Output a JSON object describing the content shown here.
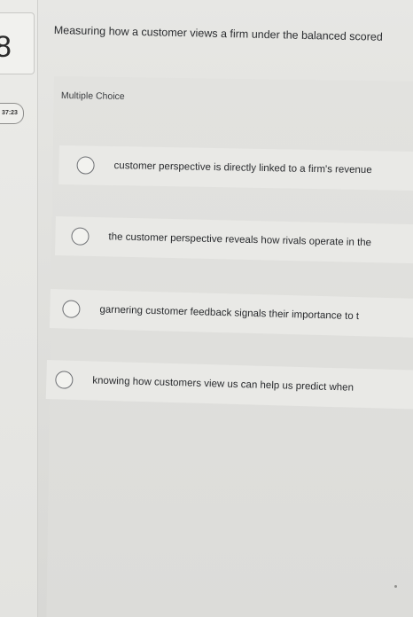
{
  "question_number": "8",
  "timer": "37:23",
  "question_text": "Measuring how a customer views a firm under the balanced scored",
  "question_type": "Multiple Choice",
  "options": [
    {
      "label": "customer perspective is directly linked to a firm's revenue"
    },
    {
      "label": "the customer perspective reveals how rivals operate in the"
    },
    {
      "label": "garnering customer feedback signals their importance to t"
    },
    {
      "label": "knowing how customers view us can help us predict when"
    }
  ],
  "colors": {
    "background": "#e3e3e0",
    "option_row": "#e9e9e6",
    "radio_border": "#6e7074",
    "text": "#2b2d30"
  },
  "icons": {
    "radio": "radio-unselected-icon"
  }
}
